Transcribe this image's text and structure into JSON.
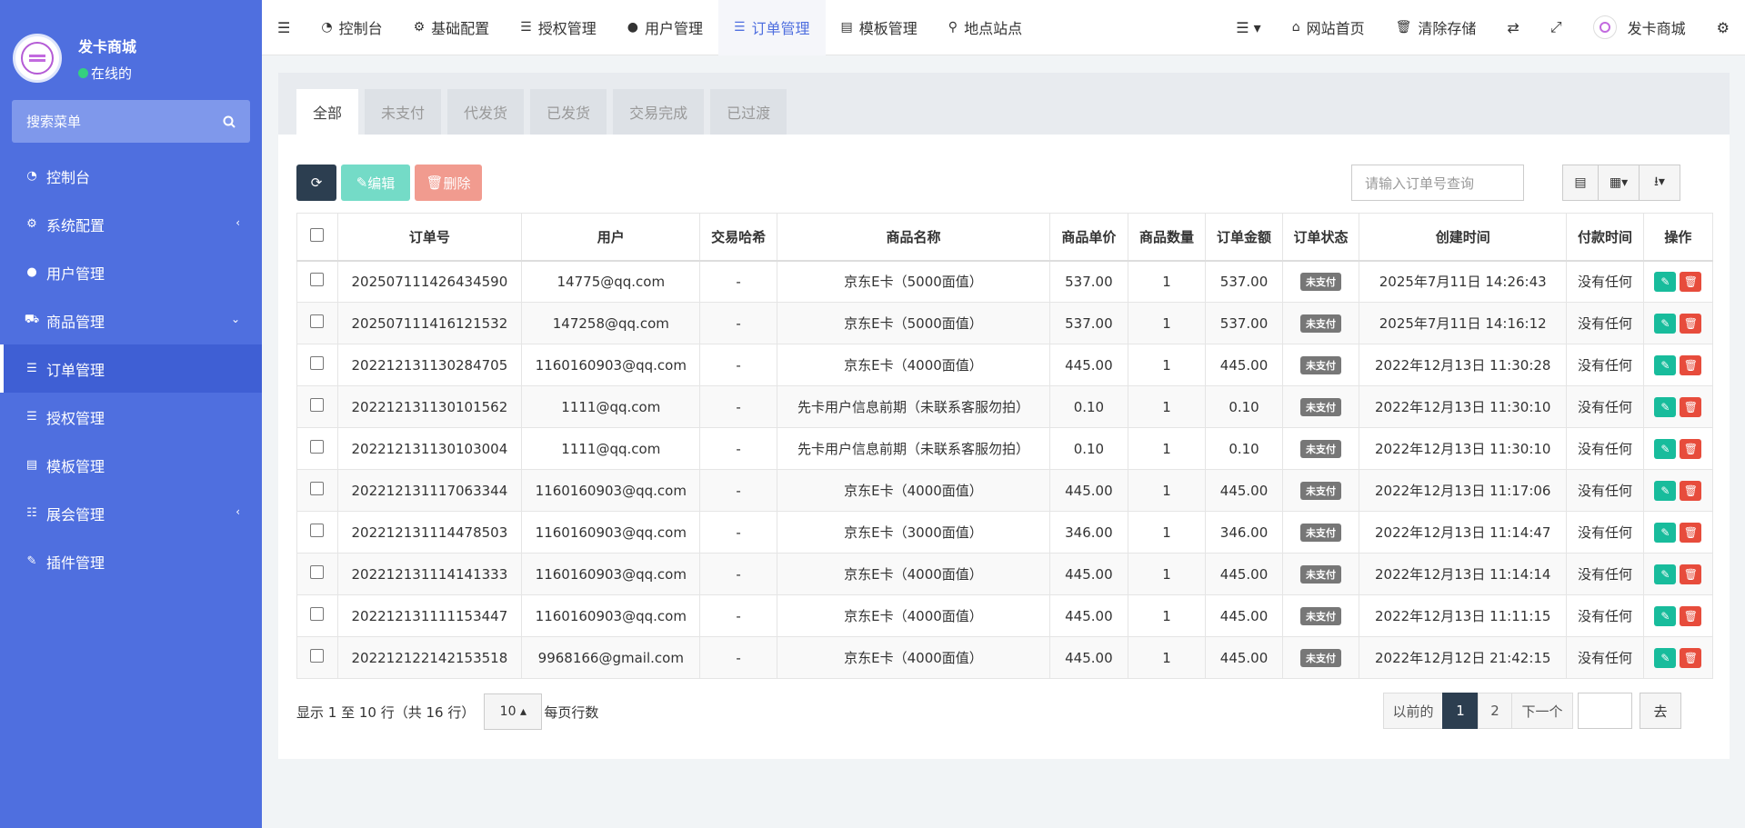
{
  "sidebar": {
    "site_name": "发卡商城",
    "status": "在线的",
    "search_placeholder": "搜索菜单",
    "items": [
      {
        "label": "控制台",
        "icon": "dashboard-icon"
      },
      {
        "label": "系统配置",
        "icon": "gear-icon",
        "caret": "‹"
      },
      {
        "label": "用户管理",
        "icon": "user-icon"
      },
      {
        "label": "商品管理",
        "icon": "cart-icon",
        "caret": "⌄"
      },
      {
        "label": "订单管理",
        "icon": "list-icon",
        "active": true
      },
      {
        "label": "授权管理",
        "icon": "list-icon"
      },
      {
        "label": "模板管理",
        "icon": "template-icon"
      },
      {
        "label": "展会管理",
        "icon": "sliders-icon",
        "caret": "‹"
      },
      {
        "label": "插件管理",
        "icon": "plugin-icon"
      }
    ]
  },
  "topbar": {
    "items": [
      {
        "label": "控制台"
      },
      {
        "label": "基础配置"
      },
      {
        "label": "授权管理"
      },
      {
        "label": "用户管理"
      },
      {
        "label": "订单管理"
      },
      {
        "label": "模板管理"
      },
      {
        "label": "地点站点"
      }
    ],
    "home": "网站首页",
    "clear_cache": "清除存储",
    "brand": "发卡商城"
  },
  "tabs": [
    "全部",
    "未支付",
    "代发货",
    "已发货",
    "交易完成",
    "已过渡"
  ],
  "toolbar": {
    "edit": "编辑",
    "delete": "删除",
    "search_placeholder": "请输入订单号查询"
  },
  "table": {
    "headers": [
      "订单号",
      "用户",
      "交易哈希",
      "商品名称",
      "商品单价",
      "商品数量",
      "订单金额",
      "订单状态",
      "创建时间",
      "付款时间",
      "操作"
    ],
    "rows": [
      [
        "202507111426434590",
        "14775@qq.com",
        "-",
        "京东E卡（5000面值）",
        "537.00",
        "1",
        "537.00",
        "未支付",
        "2025年7月11日 14:26:43",
        "没有任何"
      ],
      [
        "202507111416121532",
        "147258@qq.com",
        "-",
        "京东E卡（5000面值）",
        "537.00",
        "1",
        "537.00",
        "未支付",
        "2025年7月11日 14:16:12",
        "没有任何"
      ],
      [
        "202212131130284705",
        "1160160903@qq.com",
        "-",
        "京东E卡（4000面值）",
        "445.00",
        "1",
        "445.00",
        "未支付",
        "2022年12月13日 11:30:28",
        "没有任何"
      ],
      [
        "202212131130101562",
        "1111@qq.com",
        "-",
        "先卡用户信息前期（未联系客服勿拍）",
        "0.10",
        "1",
        "0.10",
        "未支付",
        "2022年12月13日 11:30:10",
        "没有任何"
      ],
      [
        "202212131130103004",
        "1111@qq.com",
        "-",
        "先卡用户信息前期（未联系客服勿拍）",
        "0.10",
        "1",
        "0.10",
        "未支付",
        "2022年12月13日 11:30:10",
        "没有任何"
      ],
      [
        "202212131117063344",
        "1160160903@qq.com",
        "-",
        "京东E卡（4000面值）",
        "445.00",
        "1",
        "445.00",
        "未支付",
        "2022年12月13日 11:17:06",
        "没有任何"
      ],
      [
        "202212131114478503",
        "1160160903@qq.com",
        "-",
        "京东E卡（3000面值）",
        "346.00",
        "1",
        "346.00",
        "未支付",
        "2022年12月13日 11:14:47",
        "没有任何"
      ],
      [
        "202212131114141333",
        "1160160903@qq.com",
        "-",
        "京东E卡（4000面值）",
        "445.00",
        "1",
        "445.00",
        "未支付",
        "2022年12月13日 11:14:14",
        "没有任何"
      ],
      [
        "202212131111153447",
        "1160160903@qq.com",
        "-",
        "京东E卡（4000面值）",
        "445.00",
        "1",
        "445.00",
        "未支付",
        "2022年12月13日 11:11:15",
        "没有任何"
      ],
      [
        "202212122142153518",
        "9968166@gmail.com",
        "-",
        "京东E卡（4000面值）",
        "445.00",
        "1",
        "445.00",
        "未支付",
        "2022年12月12日 21:42:15",
        "没有任何"
      ]
    ]
  },
  "footer": {
    "info": "显示 1 至 10 行（共 16 行）",
    "page_size": "10",
    "page_size_suffix": "每页行数"
  },
  "pagination": {
    "prev": "以前的",
    "pages": [
      "1",
      "2"
    ],
    "next": "下一个",
    "go": "去"
  }
}
